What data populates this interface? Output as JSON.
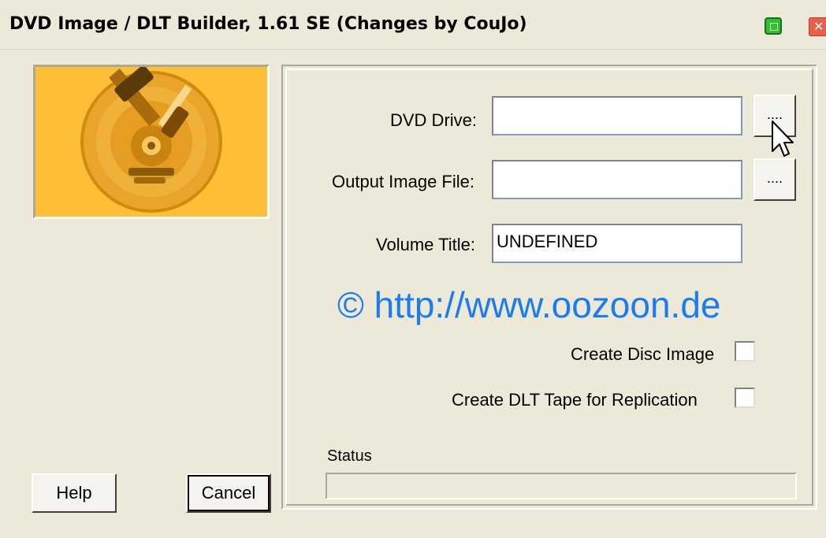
{
  "window": {
    "title": "DVD Image / DLT Builder, 1.61 SE (Changes by CouJo)"
  },
  "titlebar_buttons": {
    "minimize_icon": "green-square-icon",
    "close_icon": "close-icon"
  },
  "logo": {
    "icon": "dvd-tools-logo",
    "colors": {
      "background": "#fcbf36",
      "disc": "#e79a18"
    }
  },
  "form": {
    "dvd_drive_label": "DVD Drive:",
    "dvd_drive_value": "",
    "dvd_drive_browse": "....",
    "output_label": "Output Image File:",
    "output_value": "",
    "output_browse": "....",
    "volume_label": "Volume Title:",
    "volume_value": "UNDEFINED"
  },
  "watermark": "© http://www.oozoon.de",
  "options": {
    "create_disc_image_label": "Create Disc Image",
    "create_disc_image_checked": false,
    "create_dlt_label": "Create DLT Tape for Replication",
    "create_dlt_checked": false
  },
  "status": {
    "label": "Status",
    "progress": 0
  },
  "buttons": {
    "help": "Help",
    "cancel": "Cancel"
  },
  "colors": {
    "window_bg": "#ece9d8",
    "watermark": "#1a7cf0"
  }
}
